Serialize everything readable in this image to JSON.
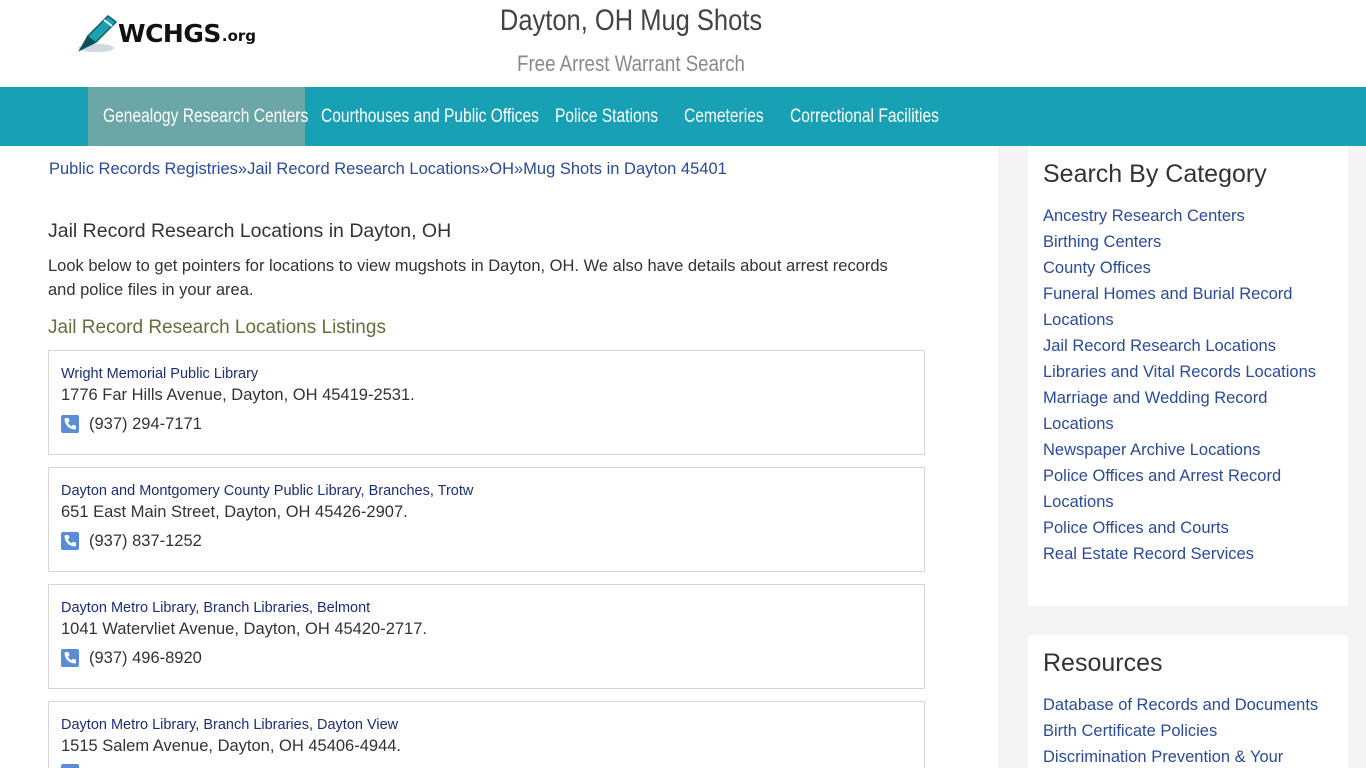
{
  "header": {
    "logo_text": "WCHGS",
    "logo_suffix": ".org",
    "title": "Dayton, OH Mug Shots",
    "subtitle": "Free Arrest Warrant Search"
  },
  "nav": {
    "items": [
      {
        "label": "Genealogy Research Centers",
        "active": true
      },
      {
        "label": "Courthouses and Public Offices",
        "active": false
      },
      {
        "label": "Police Stations",
        "active": false
      },
      {
        "label": "Cemeteries",
        "active": false
      },
      {
        "label": "Correctional Facilities",
        "active": false
      }
    ]
  },
  "breadcrumb": {
    "items": [
      "Public Records Registries",
      "Jail Record Research Locations",
      "OH",
      "Mug Shots in Dayton 45401"
    ],
    "separator": "»"
  },
  "main": {
    "heading": "Jail Record Research Locations in Dayton, OH",
    "intro": "Look below to get pointers for locations to view mugshots in Dayton, OH. We also have details about arrest records and police files in your area.",
    "listings_heading": "Jail Record Research Locations Listings",
    "listings": [
      {
        "name": "Wright Memorial Public Library",
        "address": "1776 Far Hills Avenue, Dayton, OH 45419-2531.",
        "phone": "(937) 294-7171"
      },
      {
        "name": "Dayton and Montgomery County Public Library, Branches, Trotw",
        "address": "651 East Main Street, Dayton, OH 45426-2907.",
        "phone": "(937) 837-1252"
      },
      {
        "name": "Dayton Metro Library, Branch Libraries, Belmont",
        "address": "1041 Watervliet Avenue, Dayton, OH 45420-2717.",
        "phone": "(937) 496-8920"
      },
      {
        "name": "Dayton Metro Library, Branch Libraries, Dayton View",
        "address": "1515 Salem Avenue, Dayton, OH 45406-4944.",
        "phone": ""
      }
    ]
  },
  "sidebar": {
    "category_heading": "Search By Category",
    "categories": [
      "Ancestry Research Centers",
      "Birthing Centers",
      "County Offices",
      "Funeral Homes and Burial Record Locations",
      "Jail Record Research Locations",
      "Libraries and Vital Records Locations",
      "Marriage and Wedding Record Locations",
      "Newspaper Archive Locations",
      "Police Offices and Arrest Record Locations",
      "Police Offices and Courts",
      "Real Estate Record Services"
    ],
    "resources_heading": "Resources",
    "resources": [
      "Database of Records and Documents",
      "Birth Certificate Policies",
      "Discrimination Prevention & Your"
    ]
  },
  "colors": {
    "nav_bg": "#18a0b5",
    "nav_active": "#6aa7a6",
    "link": "#2a4b9b",
    "listing_heading": "#6b6b3c"
  }
}
